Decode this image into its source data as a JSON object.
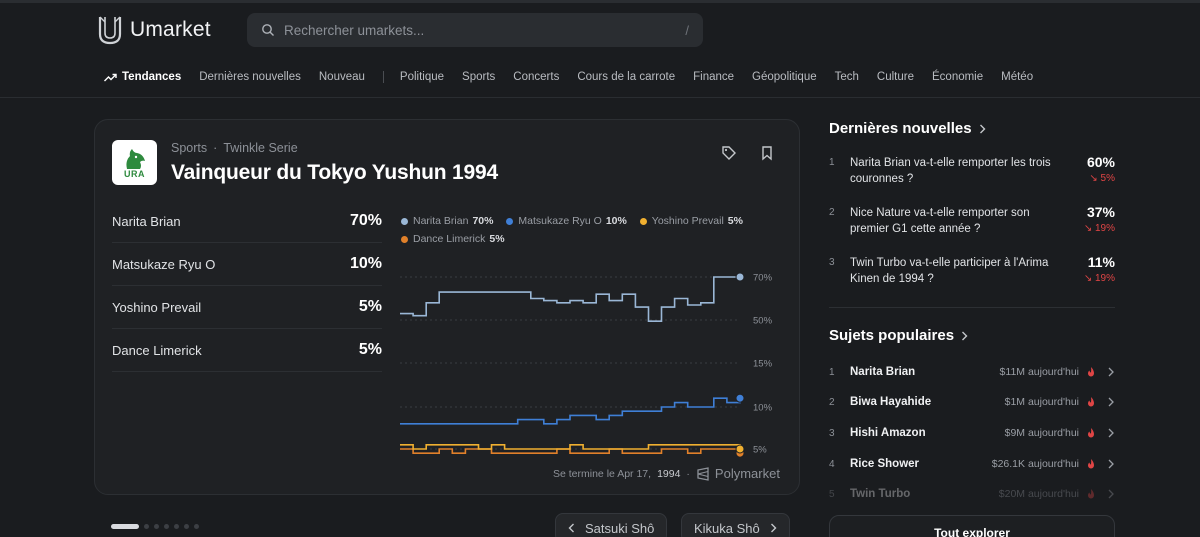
{
  "app": {
    "name": "Umarket"
  },
  "search": {
    "placeholder": "Rechercher umarkets...",
    "shortcut": "/"
  },
  "nav": {
    "active": "Tendances",
    "items_before_sep": [
      "Dernières nouvelles",
      "Nouveau"
    ],
    "items_after_sep": [
      "Politique",
      "Sports",
      "Concerts",
      "Cours de la carrote",
      "Finance",
      "Géopolitique",
      "Tech",
      "Culture",
      "Économie",
      "Météo"
    ]
  },
  "market": {
    "category": "Sports",
    "subcategory": "Twinkle Serie",
    "logo_text": "URA",
    "title": "Vainqueur du Tokyo Yushun 1994",
    "outcomes": [
      {
        "name": "Narita Brian",
        "pct": "70%"
      },
      {
        "name": "Matsukaze Ryu O",
        "pct": "10%"
      },
      {
        "name": "Yoshino Prevail",
        "pct": "5%"
      },
      {
        "name": "Dance Limerick",
        "pct": "5%"
      }
    ],
    "end_label": "Se termine le Apr 17,",
    "end_year": "1994",
    "source": "Polymarket"
  },
  "chart_data": {
    "type": "line",
    "y_ticks": [
      "70%",
      "50%",
      "15%",
      "10%",
      "5%"
    ],
    "series": [
      {
        "name": "Narita Brian",
        "label": "70%",
        "color": "#9ab7d6",
        "values": [
          53,
          52,
          58,
          63,
          63,
          63,
          63,
          63,
          63,
          63,
          60,
          59,
          58,
          59,
          58,
          62,
          59,
          62,
          56,
          49,
          56,
          60,
          57,
          58,
          70,
          70,
          70
        ]
      },
      {
        "name": "Matsukaze Ryu O",
        "label": "10%",
        "color": "#3f7fd6",
        "values": [
          8,
          8,
          8,
          8,
          8,
          8,
          8,
          8,
          8,
          8.5,
          8.5,
          8,
          8.5,
          9,
          9,
          8.5,
          9,
          9.5,
          9.5,
          9.5,
          10,
          10.5,
          10,
          10,
          11,
          10.5,
          11
        ]
      },
      {
        "name": "Yoshino Prevail",
        "label": "5%",
        "color": "#f0b030",
        "values": [
          5.5,
          5,
          5.5,
          5.5,
          5.5,
          5.5,
          5,
          5.5,
          5,
          5,
          5,
          5,
          5,
          5.5,
          5,
          5,
          5,
          5,
          5,
          5.5,
          5.5,
          5.5,
          5.5,
          5.5,
          5.5,
          5.5,
          5
        ]
      },
      {
        "name": "Dance Limerick",
        "label": "5%",
        "color": "#e0802a",
        "values": [
          5,
          4.5,
          4.5,
          5,
          4.5,
          5,
          5,
          4.5,
          4.5,
          4.5,
          4.5,
          4.5,
          5,
          4.5,
          4.5,
          4.5,
          5,
          4.5,
          4.5,
          4.5,
          5,
          5,
          4.5,
          5,
          5,
          5,
          4.5
        ]
      }
    ]
  },
  "pager": {
    "prev": "Satsuki Shô",
    "next": "Kikuka Shô"
  },
  "news": {
    "title": "Dernières nouvelles",
    "items": [
      {
        "num": "1",
        "text": "Narita Brian va-t-elle remporter les trois couronnes ?",
        "pct": "60%",
        "change": "↘ 5%"
      },
      {
        "num": "2",
        "text": "Nice Nature va-t-elle remporter son premier G1 cette année ?",
        "pct": "37%",
        "change": "↘ 19%"
      },
      {
        "num": "3",
        "text": "Twin Turbo va-t-elle participer à l'Arima Kinen de 1994 ?",
        "pct": "11%",
        "change": "↘ 19%"
      }
    ]
  },
  "topics": {
    "title": "Sujets populaires",
    "items": [
      {
        "num": "1",
        "name": "Narita Brian",
        "volume": "$11M aujourd'hui"
      },
      {
        "num": "2",
        "name": "Biwa Hayahide",
        "volume": "$1M aujourd'hui"
      },
      {
        "num": "3",
        "name": "Hishi Amazon",
        "volume": "$9M aujourd'hui"
      },
      {
        "num": "4",
        "name": "Rice Shower",
        "volume": "$26.1K aujourd'hui"
      },
      {
        "num": "5",
        "name": "Twin Turbo",
        "volume": "$20M aujourd'hui"
      }
    ],
    "explore": "Tout explorer"
  }
}
